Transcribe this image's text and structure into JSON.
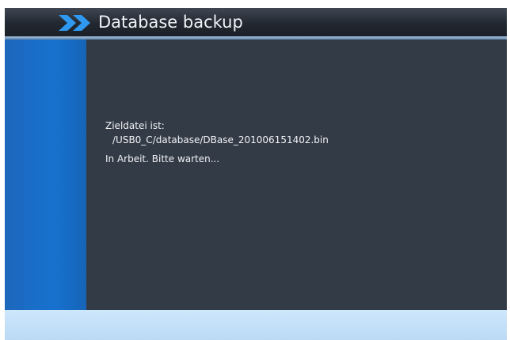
{
  "window": {
    "title": "Database backup",
    "title_icon": "double-chevron-right-icon"
  },
  "content": {
    "target_label": "Zieldatei ist:",
    "target_path": "/USB0_C/database/DBase_201006151402.bin",
    "status": "In Arbeit. Bitte warten..."
  },
  "colors": {
    "title_bar": "#222831",
    "accent_blue": "#1772cf",
    "content_bg": "#333b47",
    "bottom_bar": "#c4e1f9",
    "arrow_icon": "#2f98f0"
  }
}
